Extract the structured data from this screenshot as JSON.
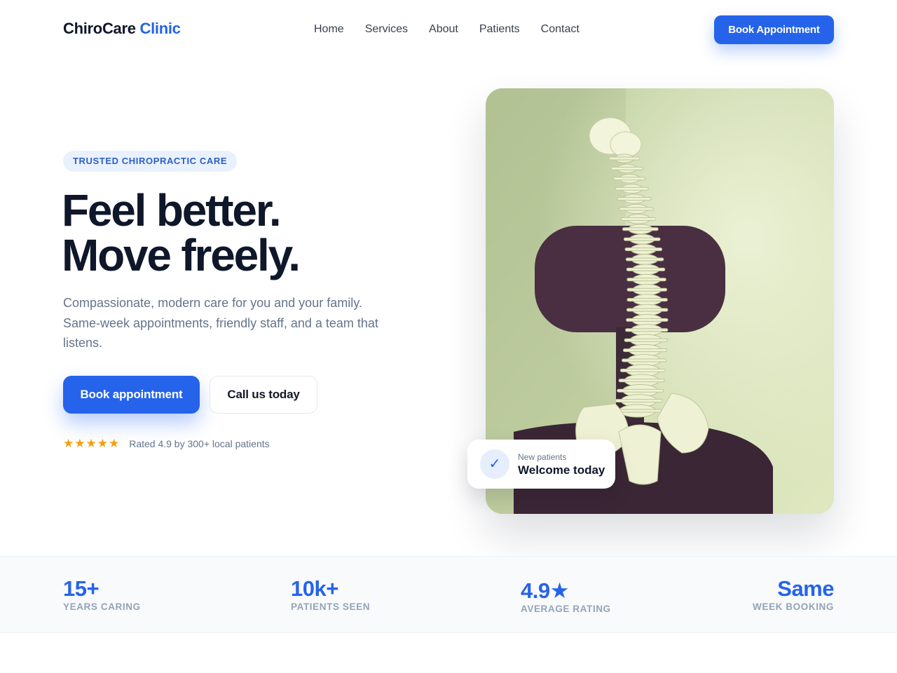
{
  "brand": {
    "name": "ChiroCare",
    "accent": "Clinic"
  },
  "nav": {
    "items": [
      {
        "label": "Home"
      },
      {
        "label": "Services"
      },
      {
        "label": "About"
      },
      {
        "label": "Patients"
      },
      {
        "label": "Contact"
      }
    ],
    "cta_label": "Book Appointment"
  },
  "hero": {
    "eyebrow": "TRUSTED CHIROPRACTIC CARE",
    "headline_line1": "Feel better.",
    "headline_line2": "Move freely.",
    "lead": "Compassionate, modern care for you and your family. Same-week appointments, friendly staff, and a team that listens.",
    "primary_button": "Book appointment",
    "secondary_button": "Call us today",
    "stars": "★★★★★",
    "rating_text": "Rated 4.9 by 300+ local patients"
  },
  "photo_badge": {
    "icon": "check-icon",
    "small": "New patients",
    "big": "Welcome today"
  },
  "stats": [
    {
      "value": "15+",
      "label": "YEARS CARING"
    },
    {
      "value": "10k+",
      "label": "PATIENTS SEEN"
    },
    {
      "value": "4.9★",
      "label": "AVERAGE RATING"
    },
    {
      "value": "Same",
      "label": "WEEK BOOKING"
    }
  ],
  "colors": {
    "accent": "#2563eb",
    "heading": "#0f172a",
    "body_text": "#64748b",
    "star": "#f59e0b",
    "stats_bg": "#f8fafc"
  }
}
